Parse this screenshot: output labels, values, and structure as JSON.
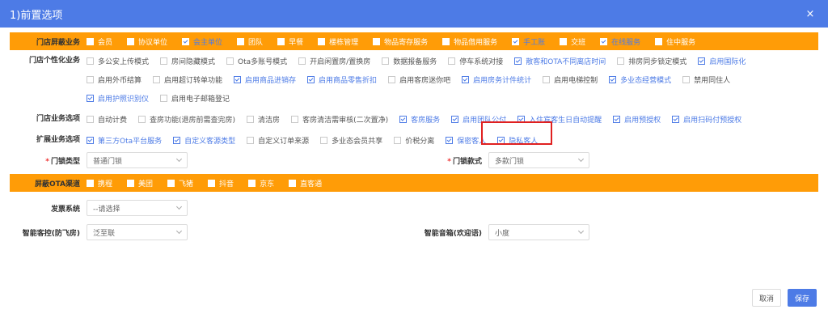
{
  "dialog": {
    "title": "1)前置选项",
    "close_icon": "×"
  },
  "sections": {
    "mendian_shield": {
      "label": "门店屏蔽业务",
      "items": [
        {
          "t": "会员",
          "on": false
        },
        {
          "t": "协议单位",
          "on": false
        },
        {
          "t": "会主单位",
          "on": true
        },
        {
          "t": "团队",
          "on": false
        },
        {
          "t": "早餐",
          "on": false
        },
        {
          "t": "楼栋管理",
          "on": false
        },
        {
          "t": "物品寄存服务",
          "on": false
        },
        {
          "t": "物品借用服务",
          "on": false
        },
        {
          "t": "手工账",
          "on": true
        },
        {
          "t": "交班",
          "on": false
        },
        {
          "t": "在线服务",
          "on": true
        },
        {
          "t": "住中服务",
          "on": false
        }
      ]
    },
    "personal": {
      "label": "门店个性化业务",
      "items": [
        {
          "t": "多公安上传模式",
          "on": false
        },
        {
          "t": "房间隐藏模式",
          "on": false
        },
        {
          "t": "Ota多账号模式",
          "on": false
        },
        {
          "t": "开启闲置房/置换房",
          "on": false
        },
        {
          "t": "数据报备服务",
          "on": false
        },
        {
          "t": "停车系统对接",
          "on": false
        },
        {
          "t": "散客和OTA不同离店时间",
          "on": true
        },
        {
          "t": "排房同步锁定模式",
          "on": false
        },
        {
          "t": "启用国际化",
          "on": true
        },
        {
          "t": "启用外币结算",
          "on": false
        },
        {
          "t": "启用超订转单功能",
          "on": false
        },
        {
          "t": "启用商品进销存",
          "on": true
        },
        {
          "t": "启用商品零售折扣",
          "on": true
        },
        {
          "t": "启用客房迷你吧",
          "on": false
        },
        {
          "t": "启用房务计件统计",
          "on": true
        },
        {
          "t": "启用电梯控制",
          "on": false
        },
        {
          "t": "多业态经营模式",
          "on": true
        },
        {
          "t": "禁用同住人",
          "on": false
        },
        {
          "t": "启用护照识别仪",
          "on": true
        },
        {
          "t": "启用电子邮箱登记",
          "on": false
        }
      ]
    },
    "business": {
      "label": "门店业务选项",
      "items": [
        {
          "t": "自动计费",
          "on": false
        },
        {
          "t": "查房功能(退房前需查完房)",
          "on": false
        },
        {
          "t": "清洁房",
          "on": false
        },
        {
          "t": "客房清洁需审核(二次置净)",
          "on": false
        },
        {
          "t": "客房服务",
          "on": true
        },
        {
          "t": "启用团队公付",
          "on": true
        },
        {
          "t": "入住宾客生日自动提醒",
          "on": true
        },
        {
          "t": "启用预授权",
          "on": true
        },
        {
          "t": "启用扫码付预授权",
          "on": true
        }
      ]
    },
    "extend": {
      "label": "扩展业务选项",
      "items": [
        {
          "t": "第三方Ota平台服务",
          "on": true
        },
        {
          "t": "自定义客源类型",
          "on": true
        },
        {
          "t": "自定义订单来源",
          "on": false
        },
        {
          "t": "多业态会员共享",
          "on": false
        },
        {
          "t": "价税分离",
          "on": false
        },
        {
          "t": "保密客人",
          "on": true
        },
        {
          "t": "隐私客人",
          "on": true
        }
      ]
    },
    "lock": {
      "type_label": "门锁类型",
      "type_value": "普通门锁",
      "style_label": "门锁款式",
      "style_value": "多款门锁"
    },
    "ota_shield": {
      "label": "屏蔽OTA渠道",
      "items": [
        {
          "t": "携程",
          "on": false
        },
        {
          "t": "美团",
          "on": false
        },
        {
          "t": "飞猪",
          "on": false
        },
        {
          "t": "抖音",
          "on": false
        },
        {
          "t": "京东",
          "on": false
        },
        {
          "t": "直客通",
          "on": false
        }
      ]
    },
    "invoice": {
      "label": "发票系统",
      "value": "--请选择"
    },
    "smart": {
      "ctrl_label": "智能客控(防飞房)",
      "ctrl_value": "泛至联",
      "speaker_label": "智能音箱(欢迎语)",
      "speaker_value": "小度"
    }
  },
  "footer": {
    "cancel": "取消",
    "save": "保存"
  }
}
